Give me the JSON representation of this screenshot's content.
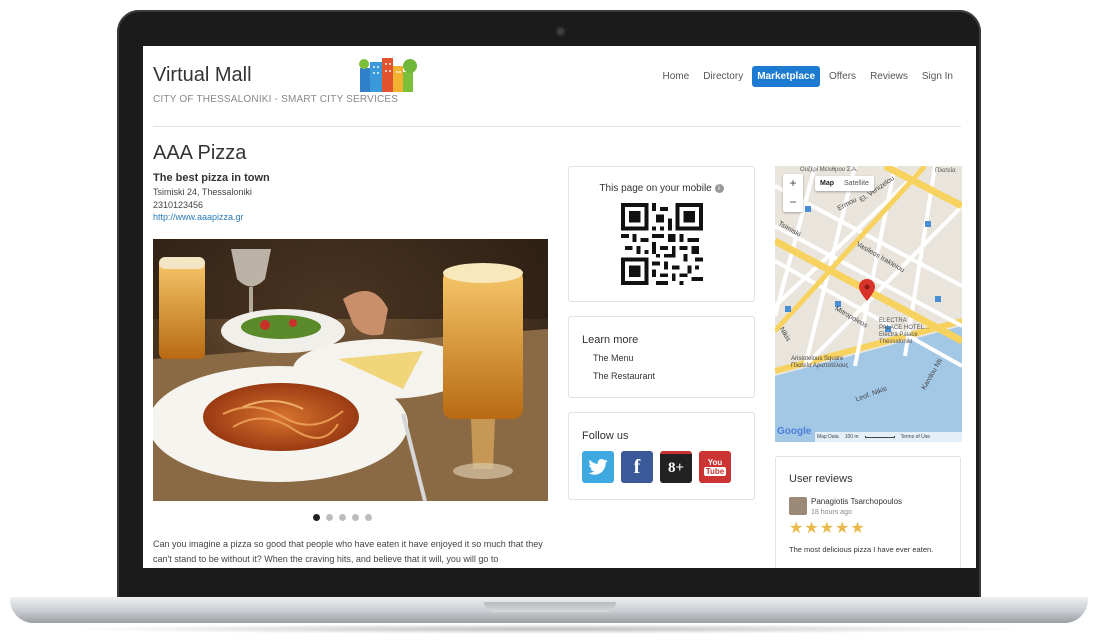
{
  "site": {
    "title": "Virtual Mall",
    "subtitle": "CITY OF THESSALONIKI - SMART CITY SERVICES"
  },
  "nav": {
    "items": [
      "Home",
      "Directory",
      "Marketplace",
      "Offers",
      "Reviews",
      "Sign In"
    ],
    "active": "Marketplace"
  },
  "colors": {
    "accent": "#1c7ad0",
    "link": "#2a7ab8",
    "twitter": "#3ea9e0",
    "facebook": "#3b5998",
    "googleplus": "#222222",
    "youtube": "#cc3333"
  },
  "business": {
    "name": "AAA Pizza",
    "tagline": "The best pizza in town",
    "address": "Tsimiski 24, Thessaloniki",
    "phone": "2310123456",
    "website": "http://www.aaapizza.gr",
    "description": "Can you imagine a pizza so good that people who have eaten it have enjoyed it so much that they can't stand to be without it? When the craving hits, and believe that it will, you will go to"
  },
  "carousel": {
    "count": 5,
    "active": 1
  },
  "mobile": {
    "title": "This page on your mobile",
    "info_icon": "info-icon"
  },
  "learn_more": {
    "title": "Learn more",
    "links": [
      "The Menu",
      "The Restaurant"
    ]
  },
  "follow": {
    "title": "Follow us",
    "icons": [
      "twitter-icon",
      "facebook-icon",
      "googleplus-icon",
      "youtube-icon"
    ],
    "glyphs": {
      "facebook": "f",
      "googleplus": "8+",
      "youtube_top": "You",
      "youtube_bottom": "Tube"
    }
  },
  "map": {
    "zoom_in": "+",
    "zoom_out": "−",
    "types": [
      "Map",
      "Satellite"
    ],
    "active_type": "Map",
    "labels": {
      "top": "Ουζερί Μελιθρου Σ.Α.",
      "plateia": "Πλατεία",
      "ermou": "Ermou",
      "venizelou": "El. Venizelou",
      "tsimiski": "Tsimiski",
      "vasileos": "Vasileos Irakleiou",
      "mitropoleos": "Mitropoleos",
      "electra1": "ELECTRA",
      "electra2": "PALACE HOTEL...",
      "electra3": "Electra Palace",
      "electra4": "Thessaloniki",
      "nikis": "Nikis",
      "leof_nikis": "Leof. Nikis",
      "karolou": "Karolou Nti",
      "aristotle1": "Aristotelous Square",
      "aristotle2": "Πλατεία Αριστοτέλους",
      "google": "Google",
      "map_data": "Map Data",
      "scale": "100 m",
      "terms": "Terms of Use"
    }
  },
  "reviews": {
    "title": "User reviews",
    "items": [
      {
        "author": "Panagiotis Tsarchopoulos",
        "time": "18 hours ago",
        "rating": 5,
        "text": "The most delicious pizza I have ever eaten."
      }
    ]
  }
}
